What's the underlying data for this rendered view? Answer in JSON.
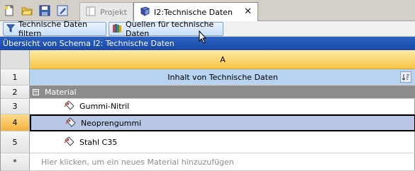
{
  "toolbar": {
    "icons": [
      "new-file-icon",
      "open-folder-icon",
      "save-icon",
      "edit-icon"
    ]
  },
  "tabs": [
    {
      "label": "Projekt",
      "active": false,
      "icon": "projekt-icon"
    },
    {
      "label": "I2:Technische Daten",
      "active": true,
      "icon": "book-icon",
      "close": "✕"
    }
  ],
  "actions": {
    "filter_label": "Technische Daten filtern",
    "sources_label": "Quellen für technische Daten"
  },
  "panel": {
    "title": "Übersicht von Schema I2: Technische Daten"
  },
  "grid": {
    "column_letter": "A",
    "row_numbers": [
      "1",
      "2",
      "3",
      "4",
      "5",
      "*"
    ],
    "column_title": "Inhalt von Technische Daten",
    "group_label": "Material",
    "collapse_symbol": "−",
    "items": [
      "Gummi-Nitril",
      "Neoprengummi",
      "Stahl C35"
    ],
    "new_row_hint": "Hier klicken, um ein neues Material hinzuzufügen"
  },
  "colors": {
    "header_blue": "#1a48a8",
    "selected_row": "#b8c7e5",
    "column_header_gold": "#f6c646",
    "group_gray": "#8c8c8c"
  }
}
